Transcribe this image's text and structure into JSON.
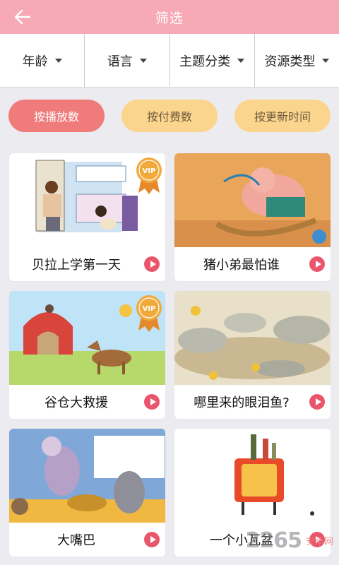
{
  "header": {
    "title": "筛选"
  },
  "filters": [
    {
      "label": "年龄"
    },
    {
      "label": "语言"
    },
    {
      "label": "主题分类"
    },
    {
      "label": "资源类型"
    }
  ],
  "sort": {
    "play_count_label": "按播放数",
    "paid_label": "按付费数",
    "updated_label": "按更新时间",
    "active": "play_count"
  },
  "books": [
    {
      "title": "贝拉上学第一天",
      "vip": true
    },
    {
      "title": "猪小弟最怕谁",
      "vip": false
    },
    {
      "title": "谷仓大救援",
      "vip": true
    },
    {
      "title": "哪里来的眼泪鱼?",
      "vip": false
    },
    {
      "title": "大嘴巴",
      "vip": false
    },
    {
      "title": "一个小瓦盆",
      "vip": false
    }
  ],
  "vip_label": "VIP",
  "watermark": {
    "number": "2265",
    "text": "安卓网"
  },
  "colors": {
    "header_bg": "#f7a9b6",
    "sort_active": "#ef7b7b",
    "sort_inactive": "#fbd48d",
    "play_button": "#e9566b",
    "vip_gold": "#f2a93b"
  }
}
